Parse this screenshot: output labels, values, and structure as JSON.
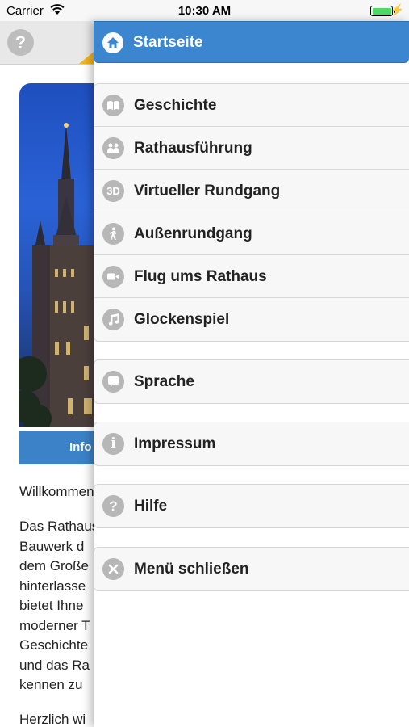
{
  "status_bar": {
    "carrier": "Carrier",
    "time": "10:30 AM",
    "battery_level": 1.0
  },
  "background": {
    "help_icon": "?",
    "info_button": "Info",
    "welcome_text": "Willkommen",
    "paragraph_lines": [
      "Das Rathaus",
      "Bauwerk d",
      "dem Große",
      "hinterlasse",
      "bietet Ihne",
      "moderner T",
      "Geschichte",
      "und das Ra",
      "kennen zu"
    ],
    "closing_text": "Herzlich wi"
  },
  "menu": {
    "home": {
      "label": "Startseite",
      "icon": "home-icon"
    },
    "group1": [
      {
        "label": "Geschichte",
        "icon": "book-icon"
      },
      {
        "label": "Rathausführung",
        "icon": "group-icon"
      },
      {
        "label": "Virtueller Rundgang",
        "icon": "3d-icon"
      },
      {
        "label": "Außenrundgang",
        "icon": "walking-icon"
      },
      {
        "label": "Flug ums Rathaus",
        "icon": "video-camera-icon"
      },
      {
        "label": "Glockenspiel",
        "icon": "music-note-icon"
      }
    ],
    "language": {
      "label": "Sprache",
      "icon": "speech-bubble-icon"
    },
    "imprint": {
      "label": "Impressum",
      "icon": "info-icon"
    },
    "help": {
      "label": "Hilfe",
      "icon": "help-icon"
    },
    "close": {
      "label": "Menü schließen",
      "icon": "close-icon"
    }
  },
  "colors": {
    "menu_header": "#3b86cf",
    "menu_icon": "#b7b7b7",
    "info_bar": "#3b82c8",
    "accent": "#f2b51c"
  }
}
